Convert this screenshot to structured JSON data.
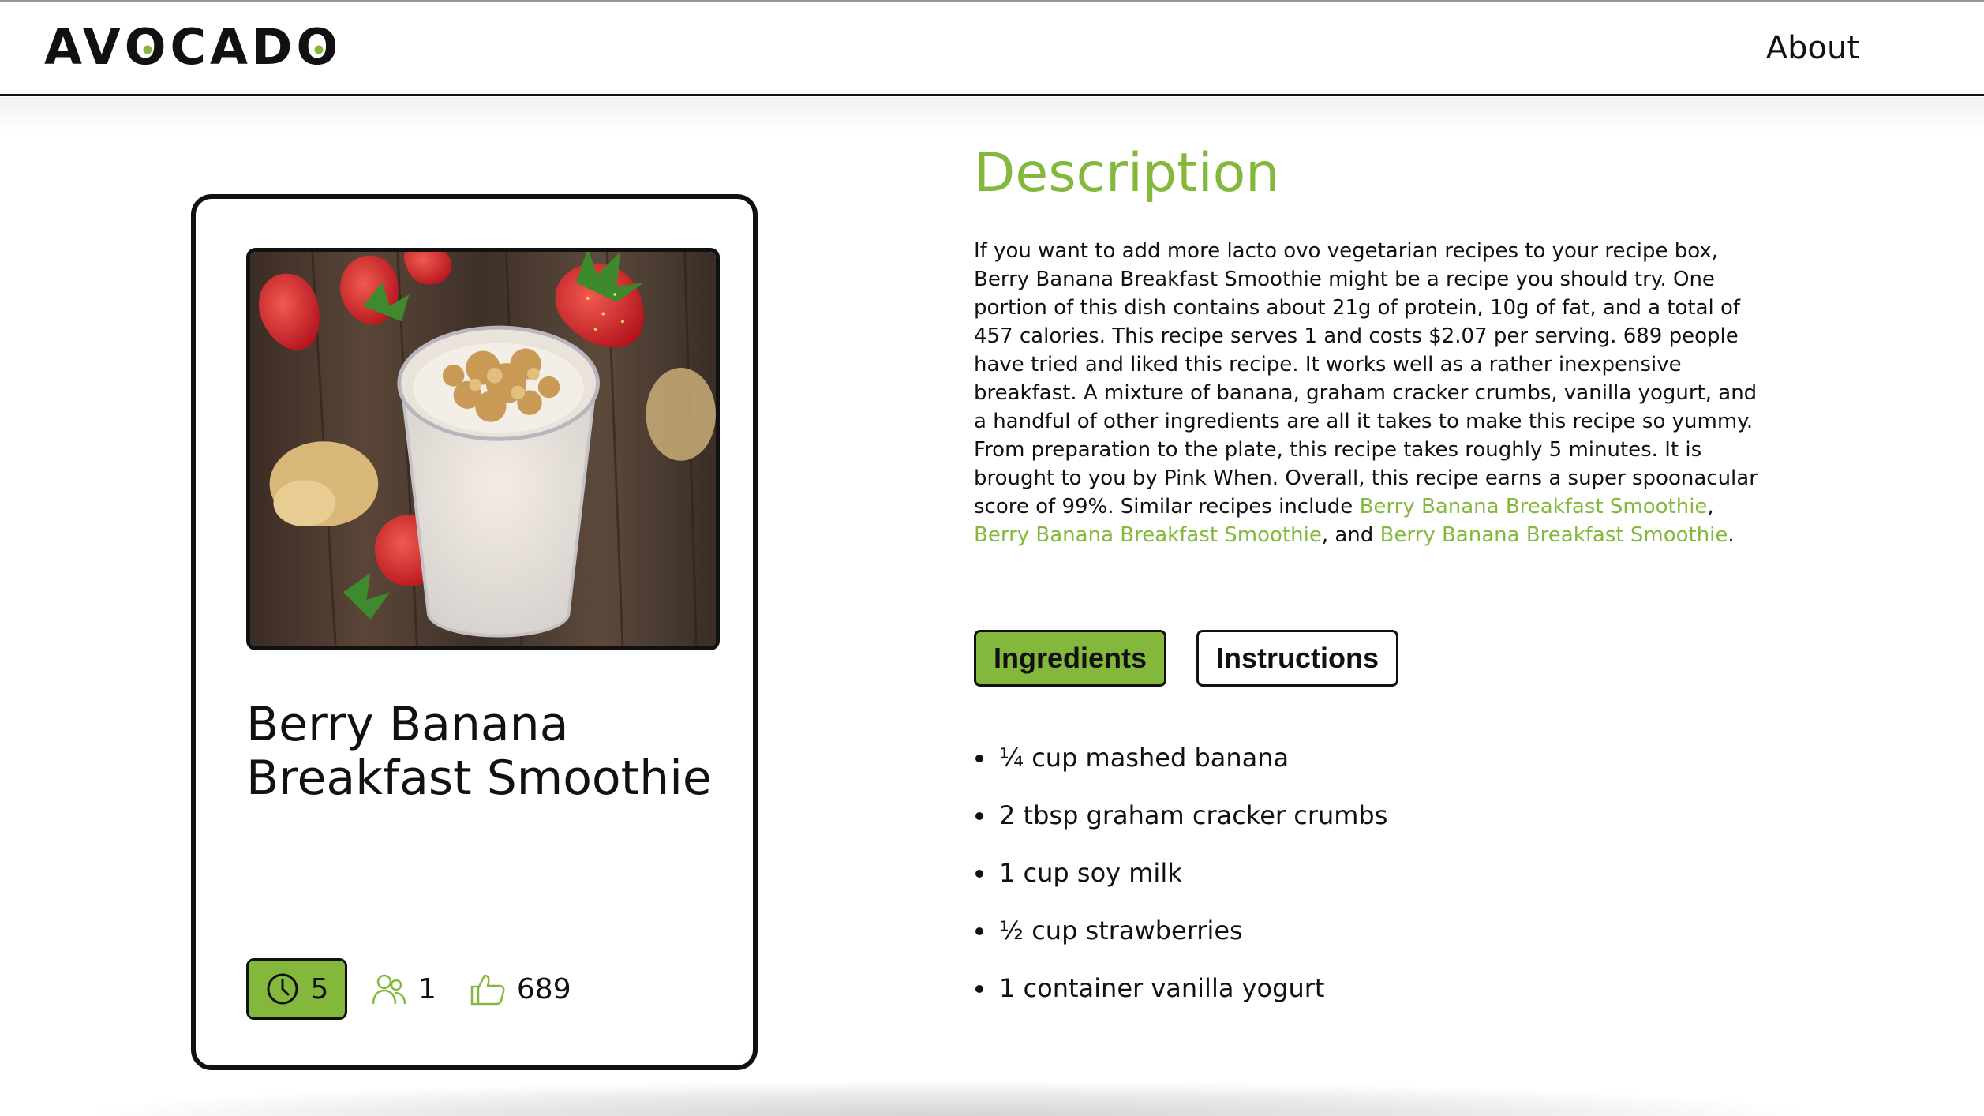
{
  "header": {
    "logo_parts": [
      "AV",
      "O",
      "C",
      "A",
      "D",
      "O"
    ],
    "nav_about": "About"
  },
  "card": {
    "title": "Berry Banana Breakfast Smoothie",
    "stats": {
      "time": "5",
      "servings": "1",
      "likes": "689"
    }
  },
  "description": {
    "heading": "Description",
    "text": "If you want to add more lacto ovo vegetarian recipes to your recipe box, Berry Banana Breakfast Smoothie might be a recipe you should try. One portion of this dish contains about 21g of protein, 10g of fat, and a total of 457 calories. This recipe serves 1 and costs $2.07 per serving. 689 people have tried and liked this recipe. It works well as a rather inexpensive breakfast. A mixture of banana, graham cracker crumbs, vanilla yogurt, and a handful of other ingredients are all it takes to make this recipe so yummy. From preparation to the plate, this recipe takes roughly 5 minutes. It is brought to you by Pink When. Overall, this recipe earns a super spoonacular score of 99%. Similar recipes include ",
    "link1": "Berry Banana Breakfast Smoothie",
    "sep1": ", ",
    "link2": "Berry Banana Breakfast Smoothie",
    "sep2": ", and ",
    "link3": "Berry Banana Breakfast Smoothie",
    "end": "."
  },
  "tabs": {
    "ingredients": "Ingredients",
    "instructions": "Instructions"
  },
  "ingredients": [
    "¼ cup mashed banana",
    "2 tbsp graham cracker crumbs",
    "1 cup soy milk",
    "½ cup strawberries",
    "1 container vanilla yogurt"
  ],
  "colors": {
    "accent": "#84b83c",
    "text": "#111111"
  }
}
